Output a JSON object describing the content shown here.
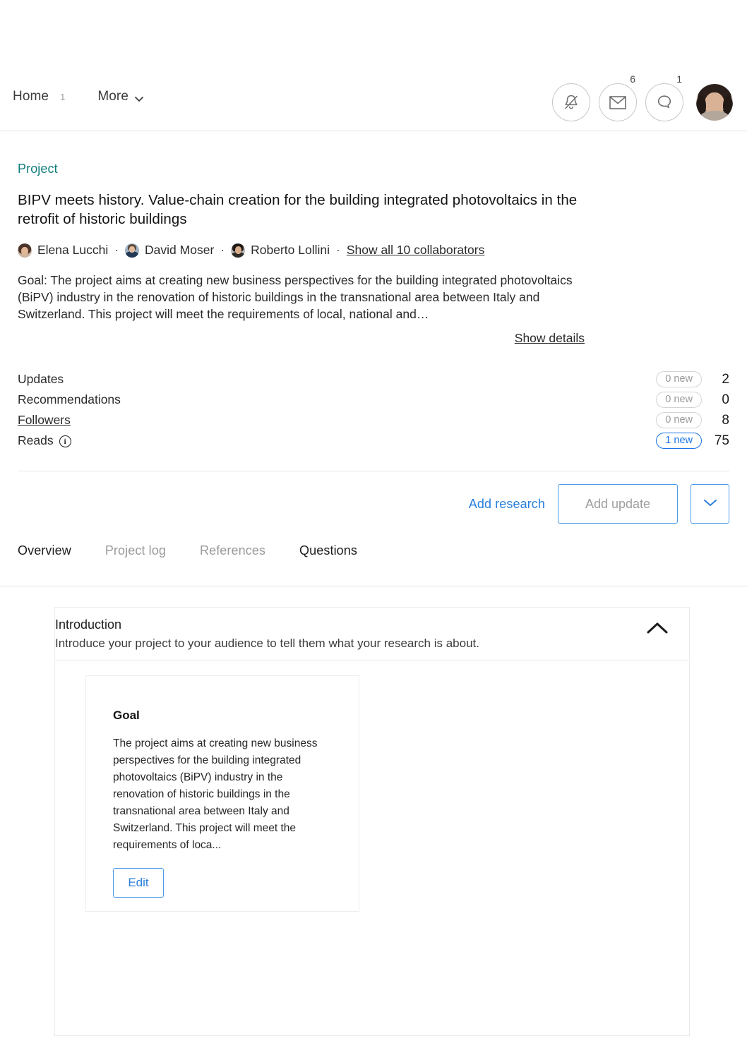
{
  "header": {
    "nav": [
      {
        "label": "Home",
        "badge": "1",
        "name": "home"
      },
      {
        "label": "More",
        "badge": "",
        "name": "more"
      }
    ],
    "icons": [
      {
        "name": "notifications-bell-icon",
        "badge": ""
      },
      {
        "name": "messages-envelope-icon",
        "badge": "6"
      },
      {
        "name": "questions-bubble-icon",
        "badge": "1"
      }
    ]
  },
  "project": {
    "kicker": "Project",
    "title": "BIPV meets history. Value-chain creation for the building integrated photovoltaics in the retrofit of historic buildings",
    "authors": [
      {
        "name": "Elena Lucchi"
      },
      {
        "name": "David Moser"
      },
      {
        "name": "Roberto Lollini"
      }
    ],
    "separator": "·",
    "show_all_collaborators": "Show all 10 collaborators",
    "goal_summary": "Goal: The project aims at creating new business perspectives for the building integrated photovoltaics (BiPV) industry in the renovation of historic buildings in the transnational area between Italy and Switzerland. This project will meet the requirements of local, national and…",
    "show_details": "Show details"
  },
  "stats": [
    {
      "label": "Updates",
      "badge": "0 new",
      "count": "2",
      "active": false,
      "underline": false,
      "info": false
    },
    {
      "label": "Recommendations",
      "badge": "0 new",
      "count": "0",
      "active": false,
      "underline": false,
      "info": false
    },
    {
      "label": "Followers",
      "badge": "0 new",
      "count": "8",
      "active": false,
      "underline": true,
      "info": false
    },
    {
      "label": "Reads",
      "badge": "1 new",
      "count": "75",
      "active": true,
      "underline": false,
      "info": true
    }
  ],
  "actions": {
    "add_research": "Add research",
    "add_update": "Add update",
    "dropdown_icon": "chevron-down-icon"
  },
  "tabs": [
    {
      "label": "Overview",
      "selected": true
    },
    {
      "label": "Project log",
      "selected": false
    },
    {
      "label": "References",
      "selected": false
    },
    {
      "label": "Questions",
      "selected": true
    }
  ],
  "introduction": {
    "title": "Introduction",
    "subtitle": "Introduce your project to your audience to tell them what your research is about.",
    "collapse_icon": "chevron-up-icon",
    "card": {
      "title": "Goal",
      "body": "The project aims at creating new business perspectives for the building integrated photovoltaics (BiPV) industry in the renovation of historic buildings in the transnational area between Italy and Switzerland. This project will meet the requirements of loca...",
      "edit_label": "Edit"
    }
  },
  "colors": {
    "kicker_teal": "#0e7c7b",
    "link_blue": "#2a7fdb",
    "accent_blue": "#1a73e8",
    "border_grey": "#e6e6e6",
    "muted_text": "#9a9a9a"
  }
}
